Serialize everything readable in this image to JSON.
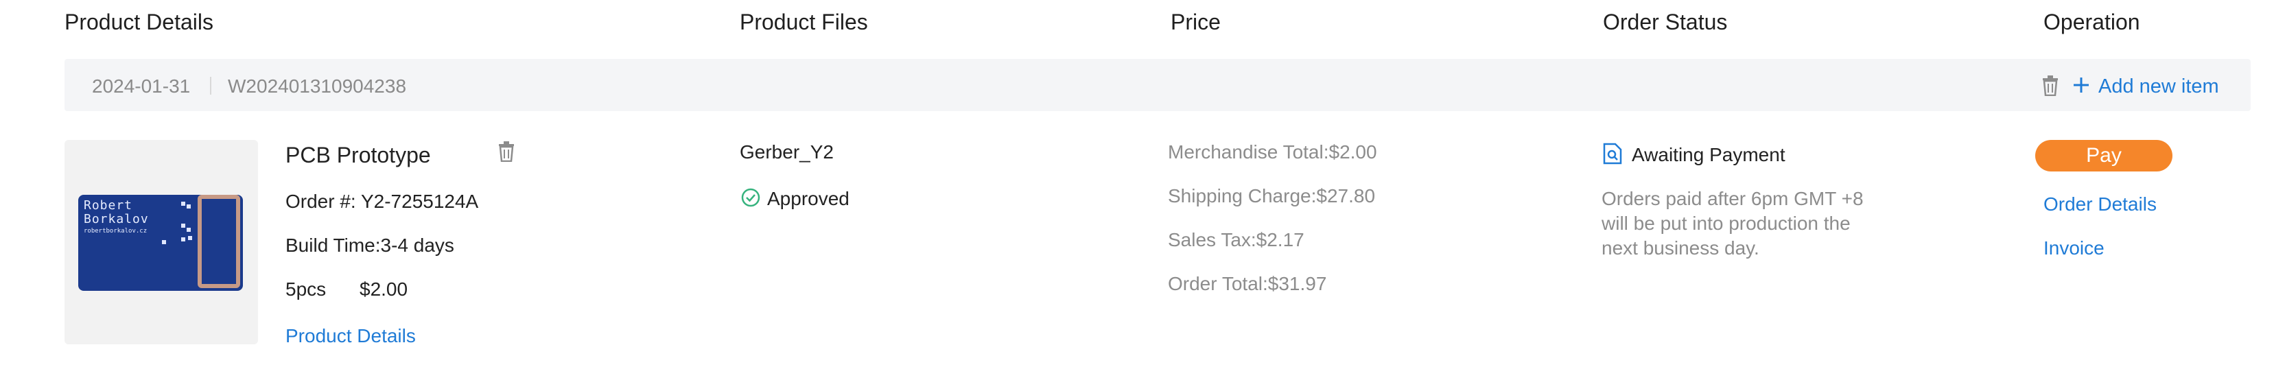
{
  "columns": {
    "details": "Product Details",
    "files": "Product Files",
    "price": "Price",
    "status": "Order Status",
    "operation": "Operation"
  },
  "order": {
    "date": "2024-01-31",
    "number": "W202401310904238",
    "add_item_label": "Add new item"
  },
  "product": {
    "title": "PCB Prototype",
    "order_no": "Order #: Y2-7255124A",
    "build_time": "Build Time:3-4 days",
    "quantity": "5pcs",
    "price": "$2.00",
    "details_link": "Product Details",
    "image": {
      "name_line1": "Robert",
      "name_line2": "Borkalov",
      "sub": "robertborkalov.cz"
    }
  },
  "files": {
    "name": "Gerber_Y2",
    "status": "Approved"
  },
  "price": {
    "merchandise": "Merchandise Total:$2.00",
    "shipping": "Shipping Charge:$27.80",
    "tax": "Sales Tax:$2.17",
    "total": "Order Total:$31.97"
  },
  "status": {
    "label": "Awaiting Payment",
    "note": "Orders paid after 6pm GMT +8 will be put into production the next business day."
  },
  "operation": {
    "pay": "Pay",
    "order_details": "Order Details",
    "invoice": "Invoice"
  },
  "colors": {
    "link": "#1f7bd6",
    "pay_button": "#f5862a",
    "approved": "#36b37e",
    "band_bg": "#f4f5f7"
  }
}
